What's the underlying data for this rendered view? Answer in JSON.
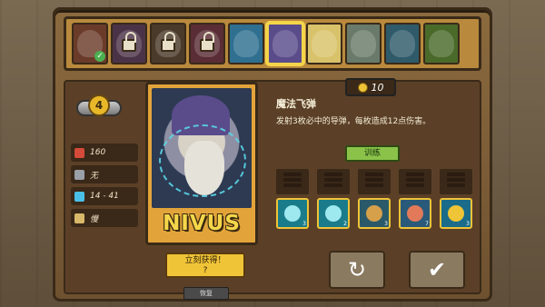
{
  "portraits": [
    {
      "name": "hero-portrait-1",
      "color": "#6b3b2a",
      "locked": false,
      "owned": true
    },
    {
      "name": "hero-portrait-2",
      "color": "#4b3347",
      "locked": true,
      "owned": false
    },
    {
      "name": "hero-portrait-3",
      "color": "#4a3a2a",
      "locked": true,
      "owned": false
    },
    {
      "name": "hero-portrait-4",
      "color": "#5a2c35",
      "locked": true,
      "owned": false
    },
    {
      "name": "hero-portrait-5",
      "color": "#2f6f8f",
      "locked": false,
      "owned": false
    },
    {
      "name": "hero-portrait-6",
      "color": "#5a4c8a",
      "locked": false,
      "owned": false,
      "selected": true
    },
    {
      "name": "hero-portrait-7",
      "color": "#d8c26a",
      "locked": false,
      "owned": false
    },
    {
      "name": "hero-portrait-8",
      "color": "#6a7a6a",
      "locked": false,
      "owned": false
    },
    {
      "name": "hero-portrait-9",
      "color": "#2f5a6a",
      "locked": false,
      "owned": false
    },
    {
      "name": "hero-portrait-10",
      "color": "#4a6a2a",
      "locked": false,
      "owned": false
    }
  ],
  "hero": {
    "level": "4",
    "name": "NIVUS"
  },
  "stats": [
    {
      "icon": "heart-icon",
      "color": "#d64a3a",
      "value": "160"
    },
    {
      "icon": "shield-icon",
      "color": "#9aa0a8",
      "value": "无"
    },
    {
      "icon": "magic-attack-icon",
      "color": "#4ac0e8",
      "value": "14 - 41"
    },
    {
      "icon": "hourglass-icon",
      "color": "#d9b86a",
      "value": "慢"
    }
  ],
  "buy": {
    "line1": "立刻获得！",
    "line2": "?"
  },
  "restore_label": "恢复",
  "skill": {
    "cost": "10",
    "title": "魔法飞弹",
    "description": "发射3枚必中的导弹，每枚造成12点伤害。",
    "train_label": "训练"
  },
  "skill_icons": [
    {
      "name": "skill-icon-1",
      "bg": "#1a7c8a",
      "glyph": "#9ee8f0",
      "count": "3"
    },
    {
      "name": "skill-icon-2",
      "bg": "#1a7c8a",
      "glyph": "#9ee8f0",
      "count": "2"
    },
    {
      "name": "skill-icon-3",
      "bg": "#2a5a6a",
      "glyph": "#d6a04a",
      "count": "3"
    },
    {
      "name": "skill-icon-4",
      "bg": "#2a5a7a",
      "glyph": "#e27a5a",
      "count": "7"
    },
    {
      "name": "skill-icon-5",
      "bg": "#1a6c8a",
      "glyph": "#f0c437",
      "count": "3"
    }
  ],
  "actions": {
    "reset_icon": "↻",
    "confirm_icon": "✔"
  }
}
